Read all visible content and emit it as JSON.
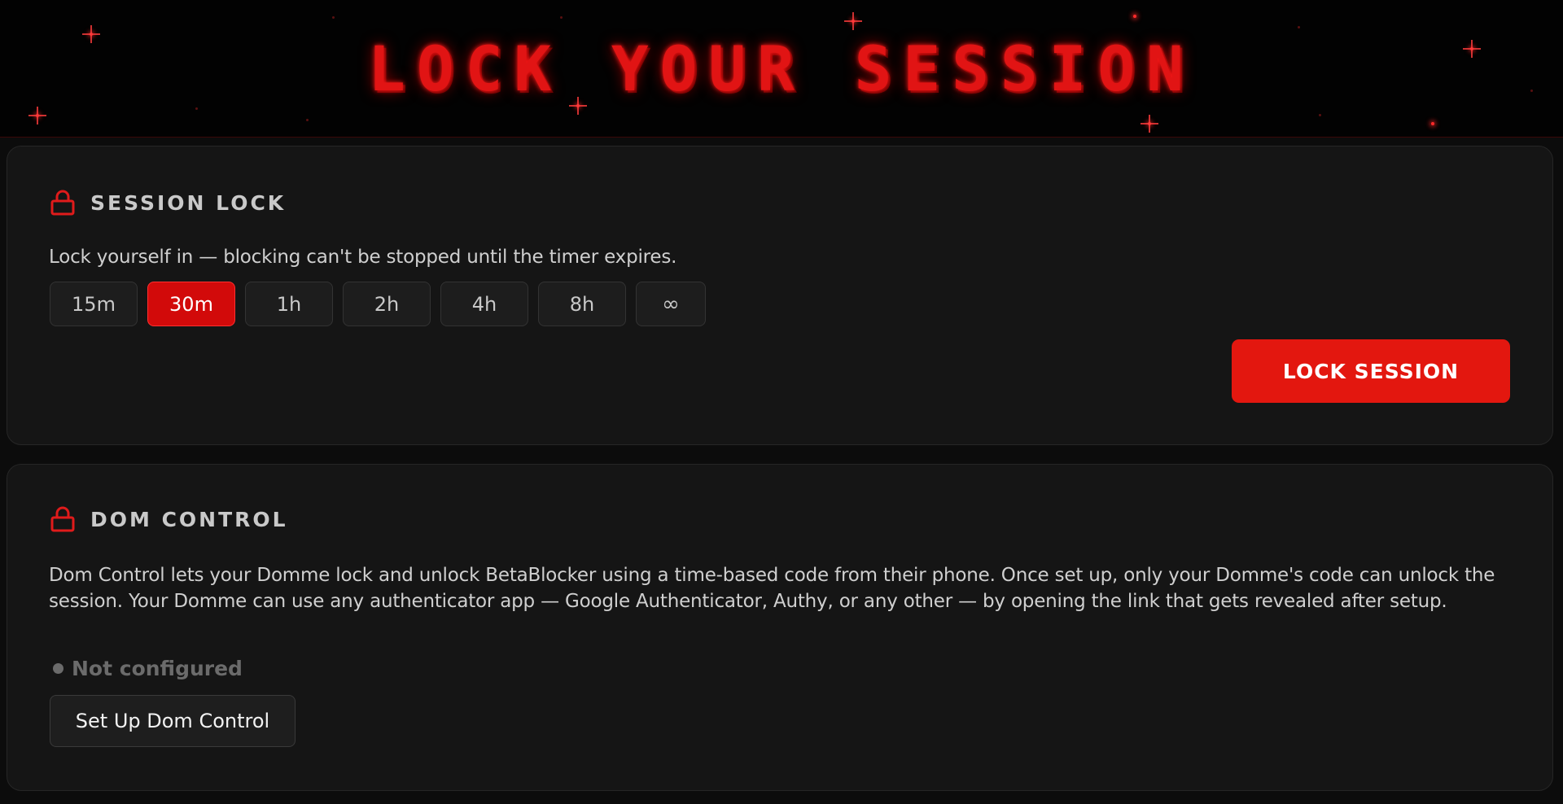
{
  "banner": {
    "title": "LOCK YOUR SESSION"
  },
  "session_lock": {
    "title": "SESSION LOCK",
    "icon": "lock-icon",
    "description": "Lock yourself in — blocking can't be stopped until the timer expires.",
    "durations": [
      "15m",
      "30m",
      "1h",
      "2h",
      "4h",
      "8h",
      "∞"
    ],
    "selected_duration": "30m",
    "lock_button_label": "LOCK SESSION"
  },
  "dom_control": {
    "title": "DOM CONTROL",
    "icon": "lock-icon",
    "description": "Dom Control lets your Domme lock and unlock BetaBlocker using a time-based code from their phone. Once set up, only your Domme's code can unlock the session. Your Domme can use any authenticator app — Google Authenticator, Authy, or any other — by opening the link that gets revealed after setup.",
    "status": "Not configured",
    "setup_button_label": "Set Up Dom Control"
  },
  "colors": {
    "accent": "#e3170f",
    "background": "#0c0c0c",
    "card": "#151515",
    "status_muted": "#6b6b6b"
  }
}
